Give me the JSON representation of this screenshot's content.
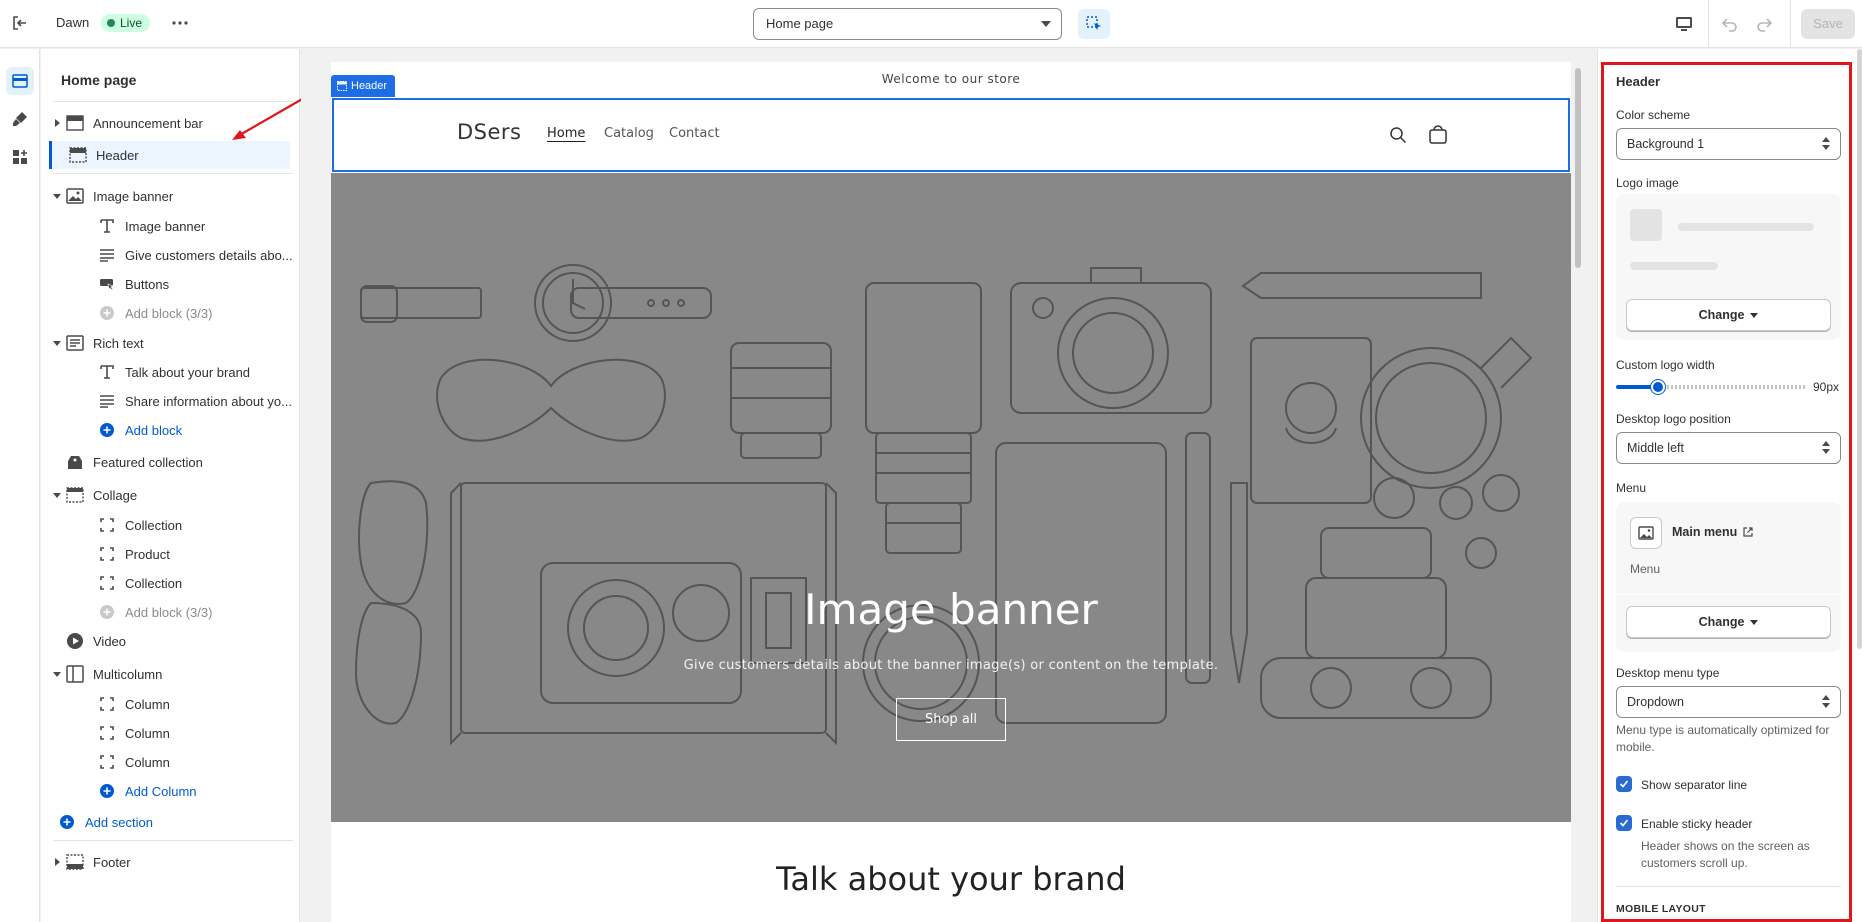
{
  "topbar": {
    "theme_name": "Dawn",
    "status_badge": "Live",
    "page_select": "Home page",
    "save_label": "Save"
  },
  "sidebar": {
    "title": "Home page",
    "header_group": [
      {
        "label": "Announcement bar",
        "icon": "layout-bar-icon"
      },
      {
        "label": "Header",
        "icon": "layout-header-icon",
        "selected": true
      }
    ],
    "template": [
      {
        "label": "Image banner",
        "icon": "image-icon",
        "children": [
          {
            "label": "Image banner",
            "icon": "text-icon"
          },
          {
            "label": "Give customers details abo...",
            "icon": "paragraph-icon"
          },
          {
            "label": "Buttons",
            "icon": "button-icon"
          },
          {
            "label": "Add block (3/3)",
            "icon": "plus-circle-icon",
            "type": "add-disabled"
          }
        ]
      },
      {
        "label": "Rich text",
        "icon": "rich-text-icon",
        "children": [
          {
            "label": "Talk about your brand",
            "icon": "text-icon"
          },
          {
            "label": "Share information about yo...",
            "icon": "paragraph-icon"
          },
          {
            "label": "Add block",
            "icon": "plus-circle-icon",
            "type": "add"
          }
        ]
      },
      {
        "label": "Featured collection",
        "icon": "tag-icon"
      },
      {
        "label": "Collage",
        "icon": "collage-icon",
        "children": [
          {
            "label": "Collection",
            "icon": "frame-icon"
          },
          {
            "label": "Product",
            "icon": "frame-icon"
          },
          {
            "label": "Collection",
            "icon": "frame-icon"
          },
          {
            "label": "Add block (3/3)",
            "icon": "plus-circle-icon",
            "type": "add-disabled"
          }
        ]
      },
      {
        "label": "Video",
        "icon": "play-circle-icon"
      },
      {
        "label": "Multicolumn",
        "icon": "columns-icon",
        "children": [
          {
            "label": "Column",
            "icon": "frame-icon"
          },
          {
            "label": "Column",
            "icon": "frame-icon"
          },
          {
            "label": "Column",
            "icon": "frame-icon"
          },
          {
            "label": "Add Column",
            "icon": "plus-circle-icon",
            "type": "add"
          }
        ]
      }
    ],
    "add_section": "Add section",
    "footer_group": [
      {
        "label": "Footer",
        "icon": "layout-footer-icon"
      }
    ]
  },
  "preview": {
    "section_tag": "Header",
    "announcement": "Welcome to our store",
    "logo": "DSers",
    "nav": [
      "Home",
      "Catalog",
      "Contact"
    ],
    "banner_title": "Image banner",
    "banner_subtitle": "Give customers details about the banner image(s) or content on the template.",
    "banner_button": "Shop all",
    "rich_text_title": "Talk about your brand"
  },
  "settings": {
    "title": "Header",
    "color_scheme_label": "Color scheme",
    "color_scheme_value": "Background 1",
    "logo_image_label": "Logo image",
    "change_label": "Change",
    "logo_width_label": "Custom logo width",
    "logo_width_value": "90px",
    "logo_width_fraction": 0.18,
    "logo_position_label": "Desktop logo position",
    "logo_position_value": "Middle left",
    "menu_label": "Menu",
    "menu_name": "Main menu",
    "menu_sub": "Menu",
    "menu_type_label": "Desktop menu type",
    "menu_type_value": "Dropdown",
    "menu_type_help": "Menu type is automatically optimized for mobile.",
    "separator_label": "Show separator line",
    "separator_checked": true,
    "sticky_label": "Enable sticky header",
    "sticky_checked": true,
    "sticky_help": "Header shows on the screen as customers scroll up.",
    "mobile_heading": "MOBILE LAYOUT"
  },
  "colors": {
    "accent": "#005bd3",
    "section_highlight": "#1d6ee6",
    "annotation_red": "#e0161b",
    "banner_bg": "#888888"
  }
}
